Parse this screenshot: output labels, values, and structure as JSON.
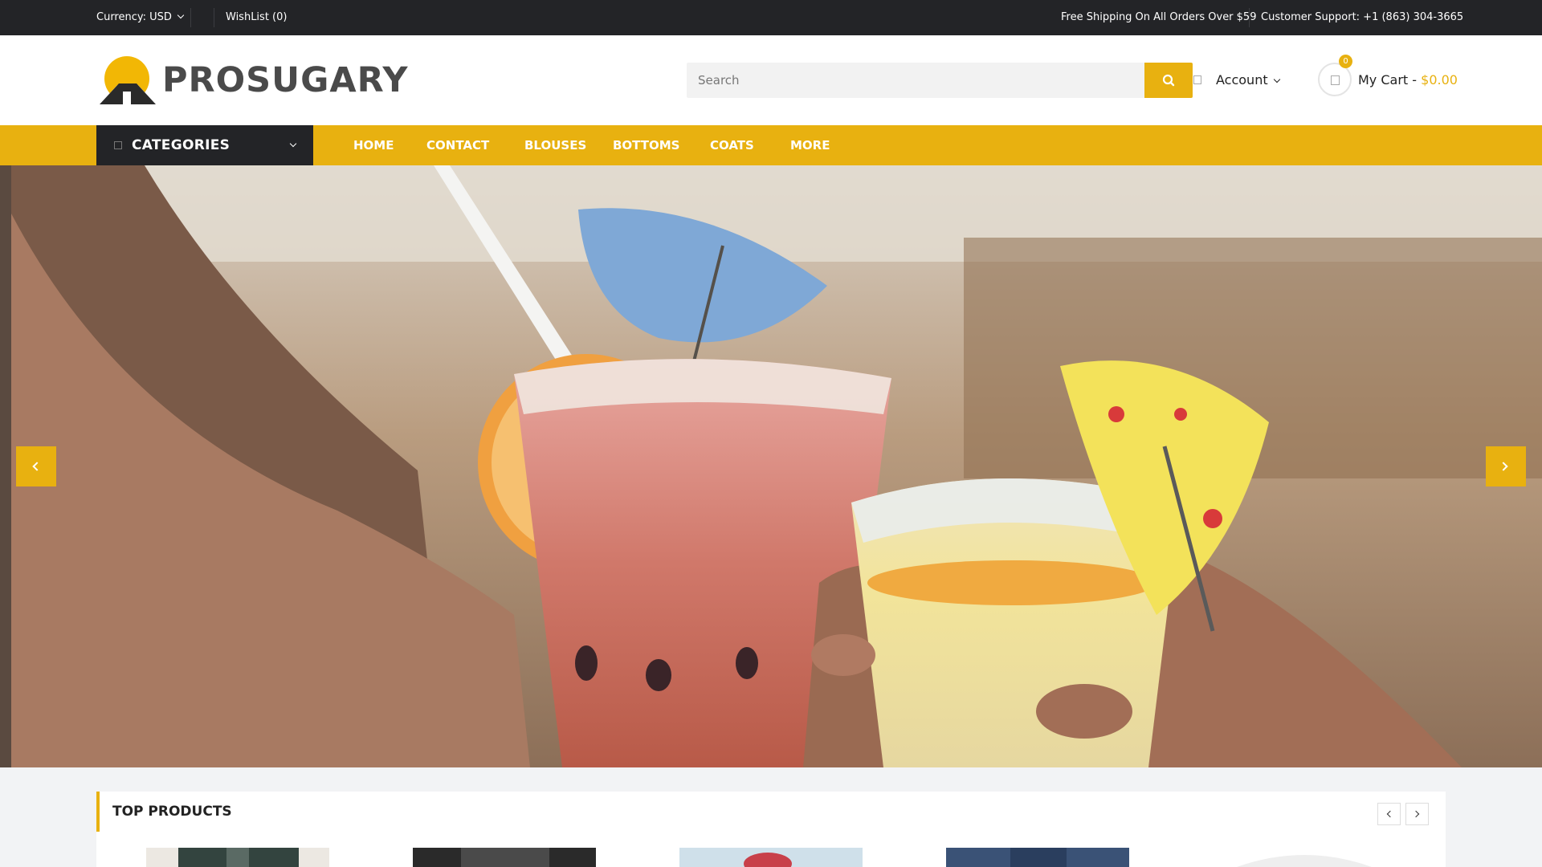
{
  "topbar": {
    "currency": "Currency: USD",
    "wishlist": "WishList (0)",
    "shipping": "Free Shipping On All Orders Over $59",
    "support": "Customer Support: +1 (863) 304-3665"
  },
  "header": {
    "logo_text": "PROSUGARY",
    "search_placeholder": "Search",
    "account_label": "Account",
    "cart_label": "My Cart - ",
    "cart_total": "$0.00",
    "cart_count": "0"
  },
  "nav": {
    "categories_label": "CATEGORIES",
    "items": [
      "HOME",
      "CONTACT",
      "BLOUSES",
      "BOTTOMS",
      "COATS",
      "MORE"
    ]
  },
  "products": {
    "title": "TOP PRODUCTS"
  },
  "colors": {
    "accent": "#e8b110",
    "dark": "#232427"
  },
  "icons": {
    "search": "search-icon",
    "user": "user-icon",
    "cart": "cart-icon",
    "chevron": "chevron-down-icon",
    "prev": "chevron-left-icon",
    "next": "chevron-right-icon"
  }
}
